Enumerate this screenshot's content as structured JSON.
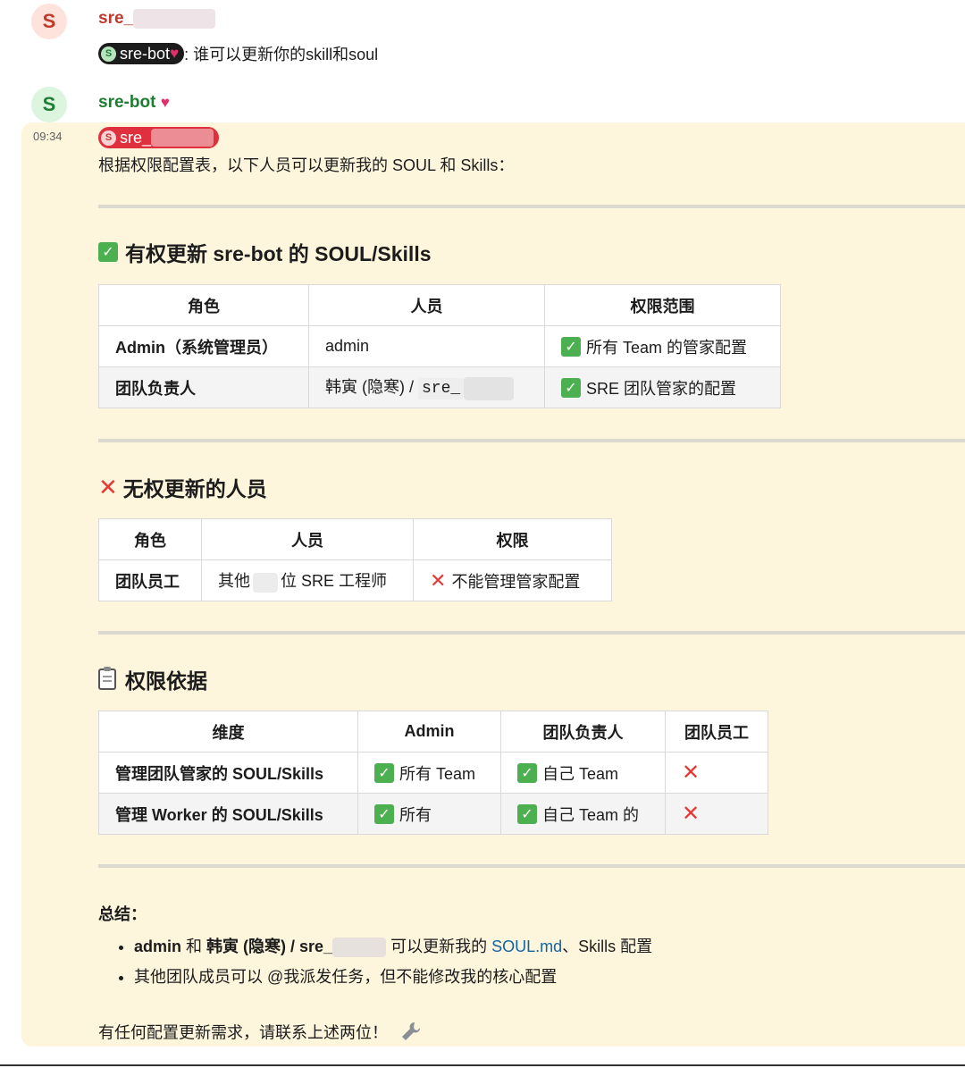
{
  "user_message": {
    "avatar_letter": "S",
    "sender": "sre_",
    "mention": "sre-bot",
    "text": ": 谁可以更新你的skill和soul"
  },
  "bot_message": {
    "avatar_letter": "S",
    "sender": "sre-bot",
    "time": "09:34",
    "mention": "sre_",
    "intro": "根据权限配置表，以下人员可以更新我的 SOUL 和 Skills："
  },
  "section1": {
    "title": "有权更新 sre-bot 的 SOUL/Skills",
    "headers": [
      "角色",
      "人员",
      "权限范围"
    ],
    "rows": [
      {
        "role": "Admin（系统管理员）",
        "person": "admin",
        "scope": "所有 Team 的管家配置"
      },
      {
        "role": "团队负责人",
        "person_name": "韩寅 (隐寒) / ",
        "person_code": "sre_",
        "scope": "SRE 团队管家的配置"
      }
    ]
  },
  "section2": {
    "title": "无权更新的人员",
    "headers": [
      "角色",
      "人员",
      "权限"
    ],
    "rows": [
      {
        "role": "团队员工",
        "person_a": "其他",
        "person_b": "位 SRE 工程师",
        "scope": "不能管理管家配置"
      }
    ]
  },
  "section3": {
    "title": "权限依据",
    "headers": [
      "维度",
      "Admin",
      "团队负责人",
      "团队员工"
    ],
    "rows": [
      {
        "dim": "管理团队管家的 SOUL/Skills",
        "admin": "所有 Team",
        "lead": "自己 Team"
      },
      {
        "dim": "管理 Worker 的 SOUL/Skills",
        "admin": "所有",
        "lead": "自己 Team 的"
      }
    ]
  },
  "summary": {
    "label": "总结：",
    "b1_bold1": "admin",
    "b1_and": " 和 ",
    "b1_bold2": "韩寅 (隐寒) / sre_",
    "b1_mid": " 可以更新我的 ",
    "b1_link": "SOUL.md",
    "b1_tail": "、Skills 配置",
    "b2": "其他团队成员可以 @我派发任务，但不能修改我的核心配置",
    "closing": "有任何配置更新需求，请联系上述两位！",
    "check_glyph": "✓",
    "cross_glyph": "✕"
  }
}
